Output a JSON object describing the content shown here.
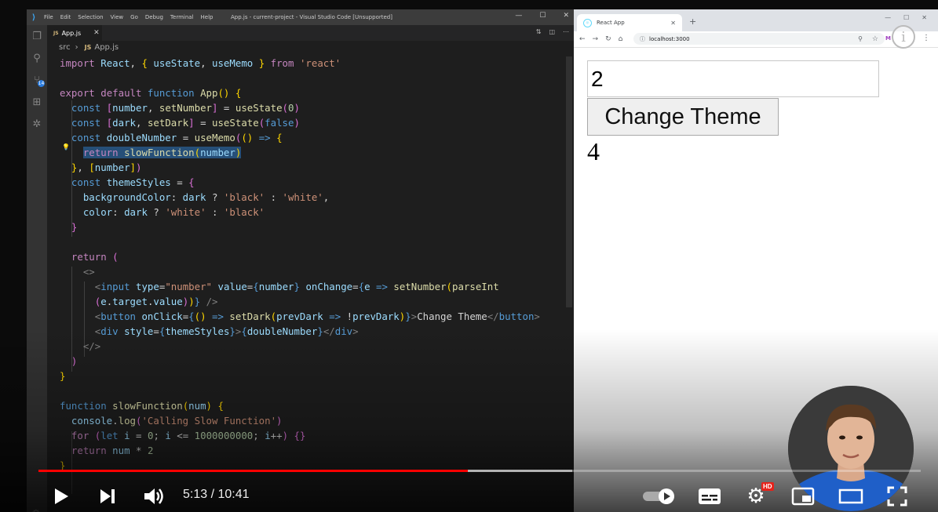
{
  "vscode": {
    "menu": [
      "File",
      "Edit",
      "Selection",
      "View",
      "Go",
      "Debug",
      "Terminal",
      "Help"
    ],
    "window_title": "App.js - current-project - Visual Studio Code [Unsupported]",
    "tab_label": "App.js",
    "tab_lang": "JS",
    "breadcrumb": {
      "folder": "src",
      "file": "App.js",
      "lang": "JS"
    },
    "scm_badge": "14"
  },
  "browser": {
    "tab_title": "React App",
    "url": "localhost:3000",
    "ext_label": "M"
  },
  "app": {
    "input_value": "2",
    "button_label": "Change Theme",
    "output_value": "4"
  },
  "player": {
    "time_current": "5:13",
    "time_total": "10:41",
    "time_display": "5:13 / 10:41",
    "hd_label": "HD",
    "progress_played_fraction": 0.487,
    "progress_buffered_fraction": 0.605,
    "colors": {
      "played": "#ff0000"
    }
  },
  "icons": {
    "play": "play-icon",
    "next": "next-icon",
    "volume": "volume-icon",
    "autoplay": "autoplay-toggle-icon",
    "subtitles": "subtitles-icon",
    "settings": "settings-icon",
    "miniplayer": "miniplayer-icon",
    "theater": "theater-icon",
    "fullscreen": "fullscreen-icon"
  }
}
